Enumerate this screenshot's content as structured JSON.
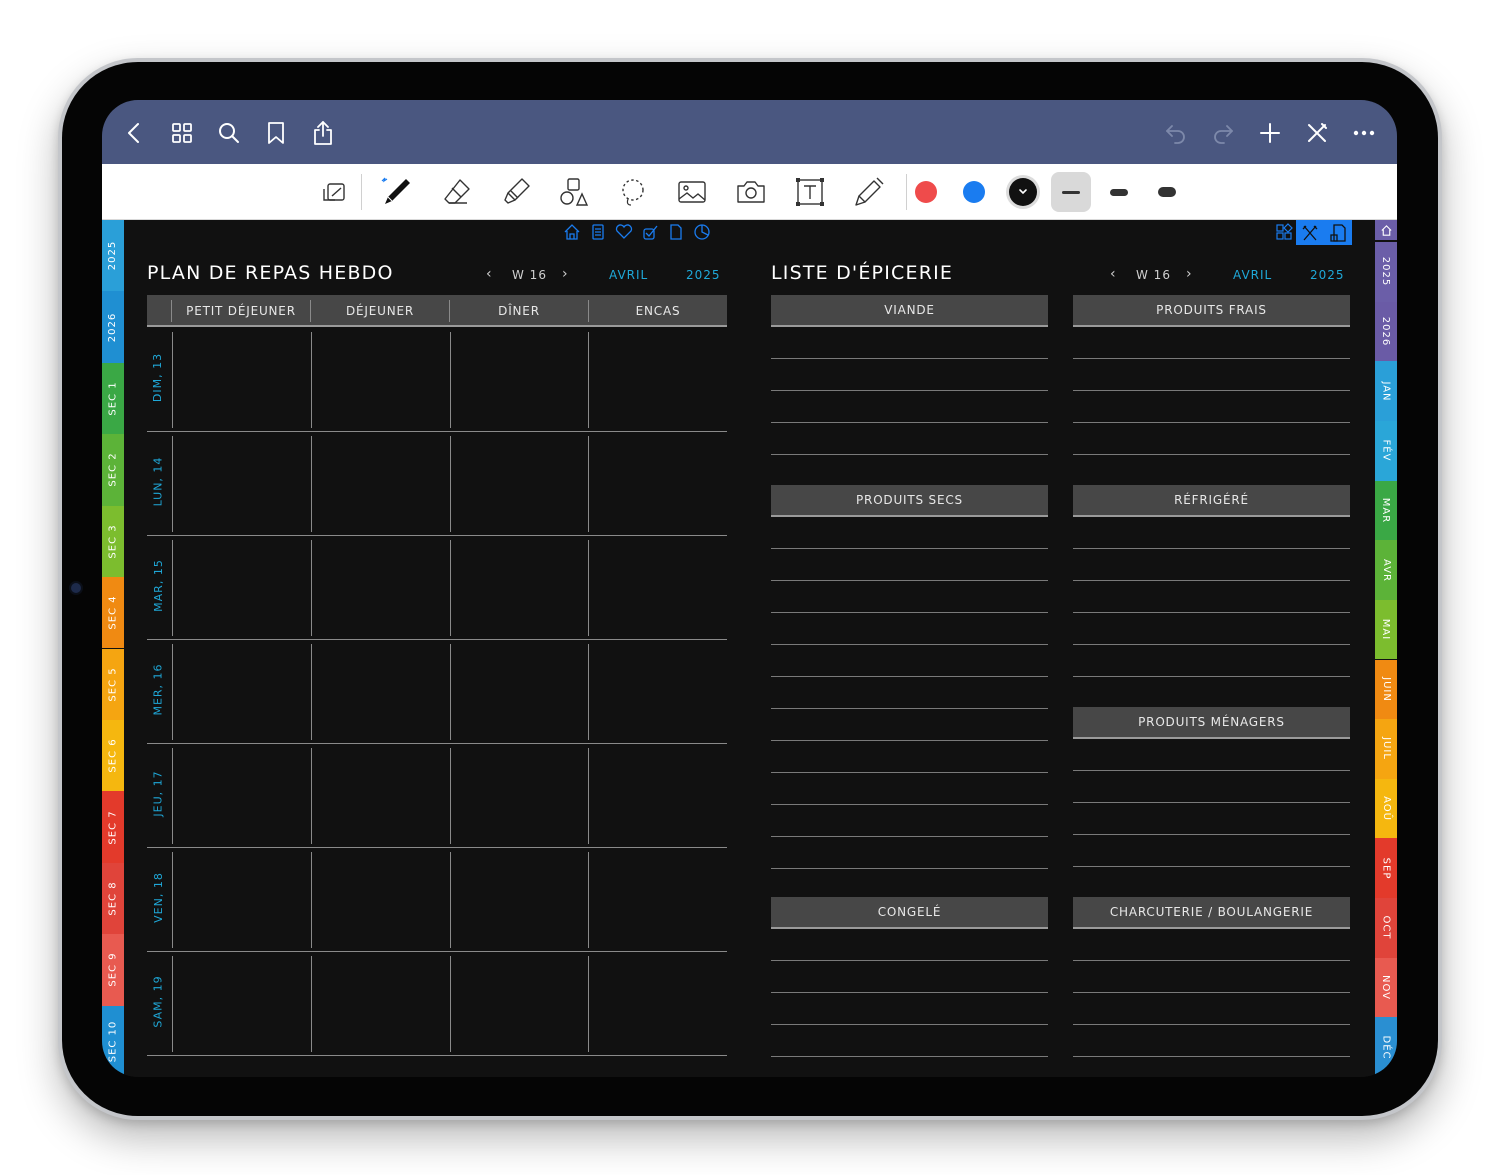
{
  "planner": {
    "title": "PLAN DE REPAS HEBDO",
    "week": "W 16",
    "month": "AVRIL",
    "year": "2025",
    "columns": [
      "PETIT DÉJEUNER",
      "DÉJEUNER",
      "DÎNER",
      "ENCAS"
    ],
    "days": [
      "DIM, 13",
      "LUN, 14",
      "MAR, 15",
      "MER, 16",
      "JEU, 17",
      "VEN, 18",
      "SAM, 19"
    ]
  },
  "grocery": {
    "title": "LISTE D'ÉPICERIE",
    "week": "W 16",
    "month": "AVRIL",
    "year": "2025",
    "sections": {
      "viande": "VIANDE",
      "produits_frais": "PRODUITS FRAIS",
      "produits_secs": "PRODUITS SECS",
      "refrigere": "RÉFRIGÉRÉ",
      "produits_menagers": "PRODUITS MÉNAGERS",
      "congele": "CONGELÉ",
      "charcuterie": "CHARCUTERIE / BOULANGERIE"
    }
  },
  "left_tabs": [
    {
      "label": "2025",
      "color": "#2a9fd8"
    },
    {
      "label": "2026",
      "color": "#1f8fd2"
    },
    {
      "label": "SEC 1",
      "color": "#3aa845"
    },
    {
      "label": "SEC 2",
      "color": "#5cb338"
    },
    {
      "label": "SEC 3",
      "color": "#7cbd2e"
    },
    {
      "label": "SEC 4",
      "color": "#f08a12"
    },
    {
      "label": "SEC 5",
      "color": "#f5a511"
    },
    {
      "label": "SEC 6",
      "color": "#f5b70f"
    },
    {
      "label": "SEC 7",
      "color": "#e33a2b"
    },
    {
      "label": "SEC 8",
      "color": "#e0443a"
    },
    {
      "label": "SEC 9",
      "color": "#e85a50"
    },
    {
      "label": "SEC 10",
      "color": "#1f8fd2"
    }
  ],
  "right_tabs": [
    {
      "label": "2025",
      "color": "#6b5ea8"
    },
    {
      "label": "2026",
      "color": "#6a5ba6"
    },
    {
      "label": "JAN",
      "color": "#2a9fd8"
    },
    {
      "label": "FÉV",
      "color": "#2aa6d8"
    },
    {
      "label": "MAR",
      "color": "#3aa845"
    },
    {
      "label": "AVR",
      "color": "#5cb338"
    },
    {
      "label": "MAI",
      "color": "#7cbd2e"
    },
    {
      "label": "JUIN",
      "color": "#f08a12"
    },
    {
      "label": "JUIL",
      "color": "#f5a511"
    },
    {
      "label": "AOÛ",
      "color": "#f5b70f"
    },
    {
      "label": "SEP",
      "color": "#e33a2b"
    },
    {
      "label": "OCT",
      "color": "#e0443a"
    },
    {
      "label": "NOV",
      "color": "#e85a50"
    },
    {
      "label": "DÉC",
      "color": "#2a8fd2"
    }
  ],
  "colors": {
    "accent": "#1fa8d8",
    "nav_bar": "#4a5780",
    "swatch_red": "#ef4b4b",
    "swatch_blue": "#1a7cf0",
    "swatch_black": "#111111"
  },
  "icons": {
    "nav_left": [
      "back-icon",
      "grid-icon",
      "search-icon",
      "bookmark-icon",
      "share-icon"
    ],
    "nav_right": [
      "undo-icon",
      "redo-icon",
      "plus-icon",
      "close-tools-icon",
      "more-icon"
    ],
    "tools": [
      "read-mode-icon",
      "pen-icon",
      "eraser-icon",
      "highlighter-icon",
      "shapes-icon",
      "lasso-icon",
      "image-icon",
      "camera-icon",
      "text-icon",
      "laser-pointer-icon"
    ],
    "page_nav": [
      "home-icon",
      "notes-icon",
      "heart-icon",
      "tasks-icon",
      "page-icon",
      "chart-icon"
    ],
    "page_nav_right": [
      "widgets-icon",
      "meal-plan-icon",
      "grocery-list-icon"
    ]
  }
}
